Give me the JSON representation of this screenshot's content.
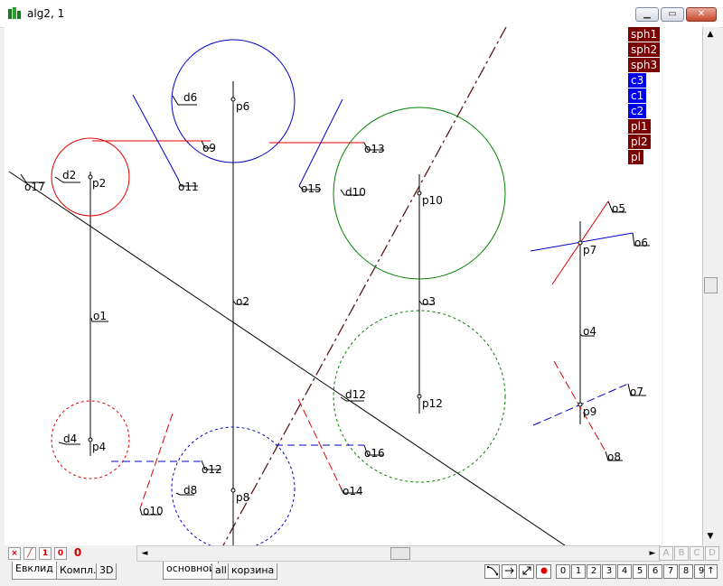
{
  "window": {
    "title": "alg2, 1"
  },
  "colors": {
    "darkred": "#7a0000",
    "blue": "#0000cc"
  },
  "objects_list": [
    {
      "label": "sph1",
      "color": "#7a0000"
    },
    {
      "label": "sph2",
      "color": "#7a0000"
    },
    {
      "label": "sph3",
      "color": "#7a0000"
    },
    {
      "label": "c3",
      "color": "#0000ee"
    },
    {
      "label": "c1",
      "color": "#0000ee"
    },
    {
      "label": "c2",
      "color": "#0000ee"
    },
    {
      "label": "pl1",
      "color": "#7a0000"
    },
    {
      "label": "pl2",
      "color": "#7a0000"
    },
    {
      "label": "pl",
      "color": "#7a0000"
    }
  ],
  "labels": {
    "o17": "o17",
    "d2": "d2",
    "p2": "p2",
    "d6": "d6",
    "p6": "p6",
    "o9": "o9",
    "o11": "o11",
    "o15": "o15",
    "o13": "o13",
    "d10": "d10",
    "p10": "p10",
    "o1": "o1",
    "o2": "o2",
    "o3": "o3",
    "d12": "d12",
    "p12": "p12",
    "d4": "d4",
    "p4": "p4",
    "o12": "o12",
    "d8": "d8",
    "p8": "p8",
    "o10": "o10",
    "o16": "o16",
    "o14": "o14",
    "o5": "o5",
    "o6": "o6",
    "p7": "p7",
    "o4": "o4",
    "o7": "o7",
    "p9": "p9",
    "o8": "o8"
  },
  "toolbar": {
    "cross": "×",
    "slash": "╱",
    "one": "1",
    "zero_small": "0",
    "zero_big": "0",
    "abcd": [
      "A",
      "B",
      "C",
      "D"
    ]
  },
  "tabs": {
    "left": [
      "Евклид",
      "Компл.",
      "3D"
    ],
    "main": [
      "основной",
      "all",
      "корзина"
    ]
  },
  "digits": [
    "0",
    "1",
    "2",
    "3",
    "4",
    "5",
    "6",
    "7",
    "8",
    "9",
    "↑"
  ],
  "scroll": {
    "up": "▲",
    "down": "▼",
    "left": "◄",
    "right": "►"
  }
}
